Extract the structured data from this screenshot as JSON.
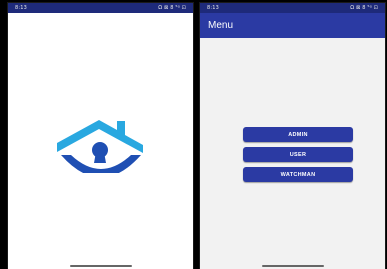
{
  "left_screen": {
    "status_time": "8:13",
    "status_icons": "Ω ⊠ 8 ⁵ᵍ ⊡"
  },
  "right_screen": {
    "status_time": "8:13",
    "status_icons": "Ω ⊠ 8 ⁵ᵍ ⊡",
    "app_title": "Menu",
    "buttons": [
      {
        "label": "ADMIN"
      },
      {
        "label": "USER"
      },
      {
        "label": "WATCHMAN"
      }
    ]
  },
  "colors": {
    "primary": "#2b3aa3",
    "status_bar": "#1e2a7a",
    "logo_light_blue": "#29a8e0",
    "logo_dark_blue": "#1f4fb3"
  },
  "icons": {
    "logo": "house-keyhole-logo"
  }
}
